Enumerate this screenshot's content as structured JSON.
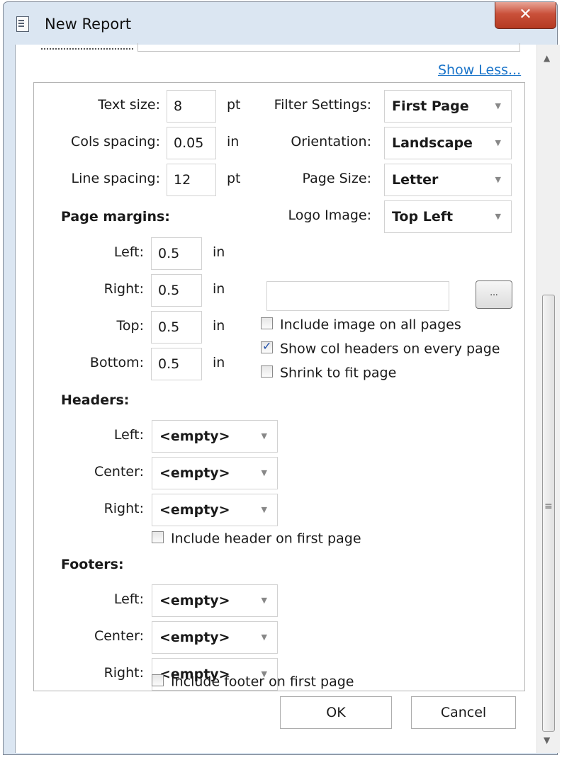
{
  "window": {
    "title": "New Report",
    "close_icon": "close-icon"
  },
  "header": {
    "show_less_label": "Show Less..."
  },
  "text_settings": {
    "text_size": {
      "label": "Text size:",
      "value": "8",
      "unit": "pt"
    },
    "cols_spacing": {
      "label": "Cols spacing:",
      "value": "0.05",
      "unit": "in"
    },
    "line_spacing": {
      "label": "Line spacing:",
      "value": "12",
      "unit": "pt"
    }
  },
  "page_settings": {
    "filter_settings": {
      "label": "Filter Settings:",
      "value": "First Page"
    },
    "orientation": {
      "label": "Orientation:",
      "value": "Landscape"
    },
    "page_size": {
      "label": "Page Size:",
      "value": "Letter"
    },
    "logo_image": {
      "label": "Logo Image:",
      "value": "Top Left"
    },
    "logo_path": "",
    "browse_label": "..."
  },
  "margins": {
    "title": "Page margins:",
    "left": {
      "label": "Left:",
      "value": "0.5",
      "unit": "in"
    },
    "right": {
      "label": "Right:",
      "value": "0.5",
      "unit": "in"
    },
    "top": {
      "label": "Top:",
      "value": "0.5",
      "unit": "in"
    },
    "bottom": {
      "label": "Bottom:",
      "value": "0.5",
      "unit": "in"
    }
  },
  "image_options": {
    "include_all_pages": {
      "label": "Include image on all pages",
      "checked": false
    },
    "show_col_headers": {
      "label": "Show col headers on every page",
      "checked": true
    },
    "shrink_to_fit": {
      "label": "Shrink to fit page",
      "checked": false
    }
  },
  "headers": {
    "title": "Headers:",
    "left": {
      "label": "Left:",
      "value": "<empty>"
    },
    "center": {
      "label": "Center:",
      "value": "<empty>"
    },
    "right": {
      "label": "Right:",
      "value": "<empty>"
    },
    "include_first": {
      "label": "Include header on first page",
      "checked": false
    }
  },
  "footers": {
    "title": "Footers:",
    "left": {
      "label": "Left:",
      "value": "<empty>"
    },
    "center": {
      "label": "Center:",
      "value": "<empty>"
    },
    "right": {
      "label": "Right:",
      "value": "<empty>"
    },
    "include_first": {
      "label": "Include footer on first page",
      "checked": false
    }
  },
  "buttons": {
    "ok": "OK",
    "cancel": "Cancel"
  },
  "scrollbar": {
    "grip": "≡",
    "up": "▲",
    "down": "▼"
  },
  "colors": {
    "link": "#1a74c9",
    "close": "#c9503a",
    "frame": "#dbe6f2"
  }
}
